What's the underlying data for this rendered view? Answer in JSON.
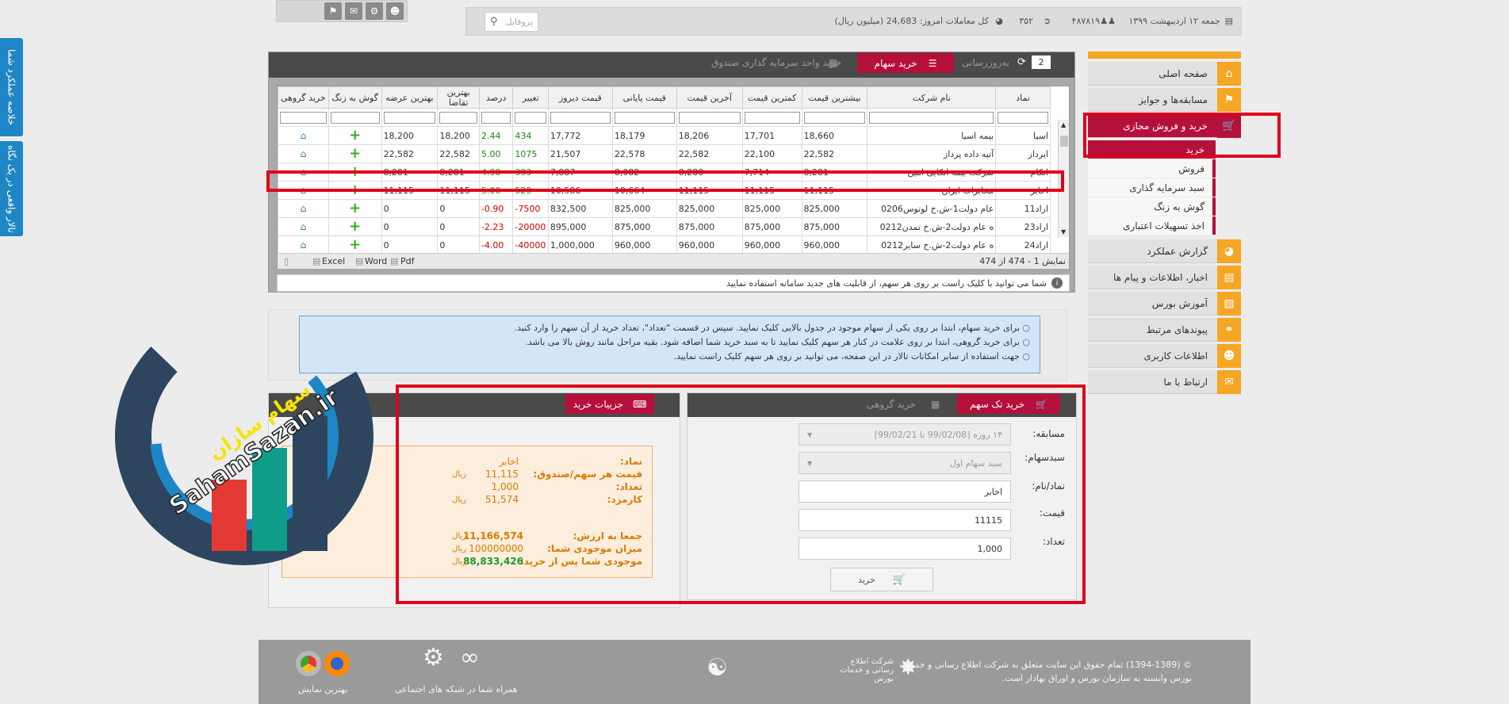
{
  "side_tabs": [
    "خلاصه عملکرد شما",
    "تالار واقعی در یک نگاه"
  ],
  "topbar": {
    "date": "جمعه ۱۲ اردیبهشت ۱۳۹۹",
    "users": "۴۸۷۸۱۹",
    "online": "۳۵۲",
    "trades": "کل معاملات امروز: 24,683 (میلیون ریال)",
    "search_placeholder": "پروفایل"
  },
  "menu": [
    {
      "label": "صفحه اصلی",
      "icon": "home-icon"
    },
    {
      "label": "مسابقه‌ها و جوایز",
      "icon": "flag-icon"
    },
    {
      "label": "خرید و فروش مجازی",
      "icon": "cart-icon",
      "active": true,
      "subs": [
        {
          "label": "خرید",
          "active": true
        },
        {
          "label": "فروش"
        },
        {
          "label": "سبد سرمایه گذاری"
        },
        {
          "label": "گوش به زنگ"
        },
        {
          "label": "اخذ تسهیلات اعتباری"
        }
      ]
    },
    {
      "label": "گزارش عملکرد",
      "icon": "pie-chart-icon"
    },
    {
      "label": "اخبار، اطلاعات و پیام ها",
      "icon": "news-icon"
    },
    {
      "label": "آموزش بورس",
      "icon": "book-icon"
    },
    {
      "label": "پیوندهای مرتبط",
      "icon": "link-icon"
    },
    {
      "label": "اطلاعات کاربری",
      "icon": "user-icon"
    },
    {
      "label": "ارتباط با ما",
      "icon": "mail-icon"
    }
  ],
  "panel": {
    "page_number": "2",
    "refresh": "بەروزرسانی",
    "tab_stock": "خرید سهام",
    "tab_fund": "خرید واحد سرمایه گذاری صندوق",
    "columns": [
      "نماد",
      "نام شرکت",
      "بیشترین قیمت",
      "کمترین قیمت",
      "آخرین قیمت",
      "قیمت پایانی",
      "قیمت دیروز",
      "تغییر",
      "درصد",
      "بهترین تقاضا",
      "بهترین عرضه",
      "گوش به زنگ",
      "خرید گروهی"
    ],
    "rows": [
      [
        "اسیا",
        "بیمه اسیا",
        "18,660",
        "17,701",
        "18,206",
        "18,179",
        "17,772",
        "434",
        "2.44",
        "18,200",
        "18,200"
      ],
      [
        "ایرداز",
        "آتیه داده پرداز",
        "22,582",
        "22,100",
        "22,582",
        "22,578",
        "21,507",
        "1075",
        "5.00",
        "22,582",
        "22,582"
      ],
      [
        "اتکام",
        "شرکت بیمه اتکایی امین",
        "8,281",
        "7,714",
        "8,280",
        "8,082",
        "7,887",
        "393",
        "4.98",
        "8,281",
        "8,281"
      ],
      [
        "اخابر",
        "مخابرات ایران",
        "11,115",
        "11,115",
        "11,115",
        "10,664",
        "10,586",
        "529",
        "5.00",
        "11,115",
        "11,115"
      ],
      [
        "اراد11",
        "عام دولت1-ش.خ لوتوس0206",
        "825,000",
        "825,000",
        "825,000",
        "825,000",
        "832,500",
        "-7500",
        "-0.90",
        "0",
        "0"
      ],
      [
        "اراد23",
        "ه عام دولت2-ش.خ تمدن0212",
        "875,000",
        "875,000",
        "875,000",
        "875,000",
        "895,000",
        "-20000",
        "-2.23",
        "0",
        "0"
      ],
      [
        "اراد24",
        "ه عام دولت2-ش.خ سایر0212",
        "960,000",
        "960,000",
        "960,000",
        "960,000",
        "1,000,000",
        "-40000",
        "-4.00",
        "0",
        "0"
      ]
    ],
    "footer_count": "نمایش 1 - 474 از 474",
    "export": [
      "Pdf",
      "Word",
      "Excel"
    ],
    "info": "شما می توانید با کلیک راست بر روی هر سهم، از قابلیت های جدید سامانه استفاده نمایید"
  },
  "help": [
    "برای خرید سهام، ابتدا بر روی یکی از سهام موجود در جدول بالایی کلیک نمایید. سپس در قسمت \"تعداد\"، تعداد خرید از آن سهم را وارد کنید.",
    "برای خرید گروهی، ابتدا بر روی علامت  در کنار هر سهم کلیک نمایید تا به سبد خرید شما اضافه شود. بقیه مراحل مانند روش بالا می باشد.",
    "جهت استفاده از سایر امکانات تالار در این صفحه، می توانید بر روی هر سهم کلیک راست نمایید."
  ],
  "buy": {
    "tab_single": "خرید تک سهم",
    "tab_group": "خرید گروهی",
    "competition_label": "مسابقه:",
    "competition_value": "۱۴ روزه [99/02/08 تا 99/02/21]",
    "basket_label": "سبدسهام:",
    "basket_value": "سبد سهام اول",
    "symbol_label": "نماد/نام:",
    "symbol_value": "اخابر",
    "price_label": "قیمت:",
    "price_value": "11115",
    "qty_label": "تعداد:",
    "qty_value": "1,000",
    "buy_button": "خرید"
  },
  "details": {
    "title": "جزییات خرید",
    "symbol_label": "نماد:",
    "symbol": "اخابر",
    "price_label": "قیمت هر سهم/صندوق:",
    "price": "11,115",
    "qty_label": "تعداد:",
    "qty": "1,000",
    "fee_label": "کارمزد:",
    "fee": "51,574",
    "total_label": "جمعا به ارزش:",
    "total": "11,166,574",
    "balance_label": "میزان موجودی شما:",
    "balance": "100000000",
    "after_label": "موجودی شما پس از خرید:",
    "after": "88,833,426",
    "unit": "ریال"
  },
  "logo": {
    "fa": "سهام سازان",
    "en": "SahamSazan.ir"
  },
  "footer": {
    "copyright1": "© (1394-1389) تمام حقوق این سایت متعلق به شرکت اطلاع رسانی و خدمات",
    "copyright2": "بورس وابسته به سازمان بورس و اوراق بهادار است.",
    "company": "شرکت اطلاع رسانی و خدمات بورس",
    "social": "همراه شما در شبکه های اجتماعی",
    "browsers": "بهترین نمایش"
  },
  "colors": {
    "accent": "#b5103a",
    "menu_icon": "#f5a623",
    "highlight": "#e0001a"
  }
}
